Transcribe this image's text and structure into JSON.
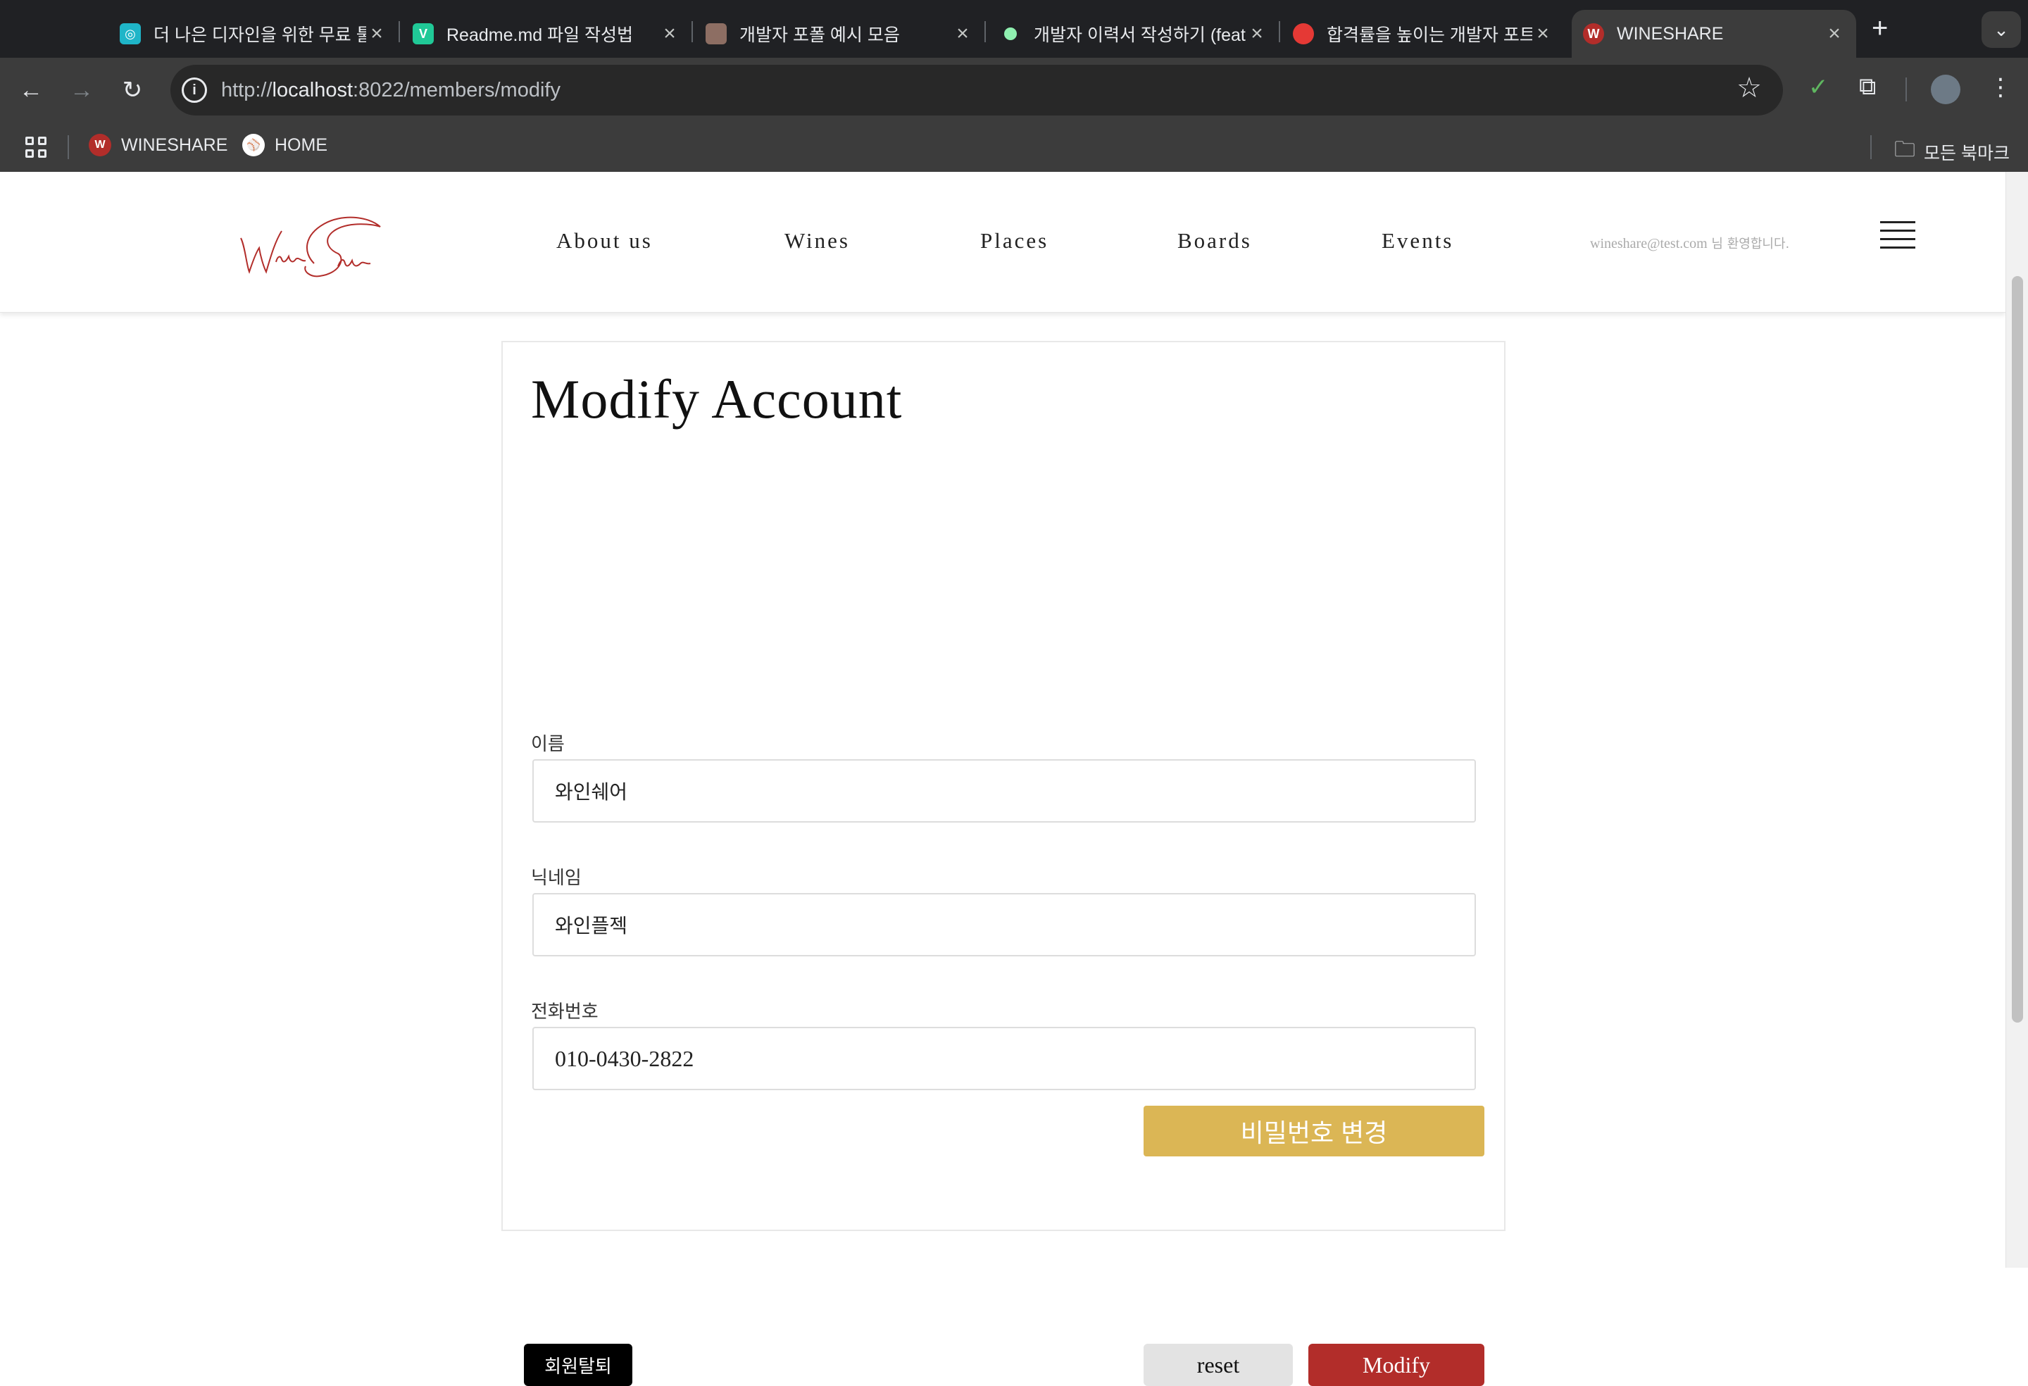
{
  "browser": {
    "tabs": [
      {
        "title": "더 나은 디자인을 위한 무료 툴",
        "icon": "figma-like-icon",
        "color": "#1fb5c8"
      },
      {
        "title": "Readme.md 파일 작성법",
        "icon": "velog-icon",
        "color": "#20c997"
      },
      {
        "title": "개발자 포폴 예시 모음",
        "icon": "image-icon",
        "color": "#8d6e63"
      },
      {
        "title": "개발자 이력서 작성하기 (feat",
        "icon": "dot-icon",
        "color": "#8ff0b0"
      },
      {
        "title": "합격률을 높이는 개발자 포트폴",
        "icon": "ball-icon",
        "color": "#e53935"
      },
      {
        "title": "WINESHARE",
        "icon": "wineshare-icon",
        "color": "#b22d2a"
      }
    ],
    "url_prefix": "http://",
    "url_host": "localhost",
    "url_rest": ":8022/members/modify",
    "bookmarks": [
      {
        "label": "WINESHARE"
      },
      {
        "label": "HOME"
      }
    ],
    "all_bookmarks": "모든 북마크"
  },
  "site": {
    "nav": [
      "About us",
      "Wines",
      "Places",
      "Boards",
      "Events"
    ],
    "welcome_email": "wineshare@test.com",
    "welcome_suffix": " 님 환영합니다.",
    "page_title": "Modify Account",
    "fields": [
      {
        "label": "이름",
        "value": "와인쉐어"
      },
      {
        "label": "닉네임",
        "value": "와인플젝"
      },
      {
        "label": "전화번호",
        "value": "010-0430-2822"
      }
    ],
    "change_password": "비밀번호 변경",
    "withdraw": "회원탈퇴",
    "reset": "reset",
    "modify": "Modify"
  },
  "colors": {
    "brand": "#b22d2a",
    "password_button": "#dbb655",
    "withdraw_button": "#000000",
    "reset_button": "#e3e3e3"
  }
}
